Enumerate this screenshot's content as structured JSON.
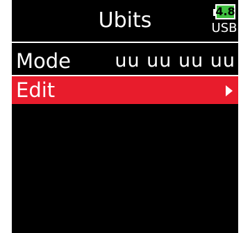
{
  "header": {
    "title": "Ubits",
    "battery_level": "4.8",
    "power_source": "USB"
  },
  "menu": {
    "items": [
      {
        "label": "Mode",
        "value": "uu uu uu uu",
        "selected": false
      },
      {
        "label": "Edit",
        "selected": true,
        "icon": "triangle-right-arrow"
      }
    ]
  },
  "colors": {
    "background": "#000000",
    "text": "#ffffff",
    "selection": "#e81c2c",
    "battery_fill": "#3fbf3f"
  }
}
